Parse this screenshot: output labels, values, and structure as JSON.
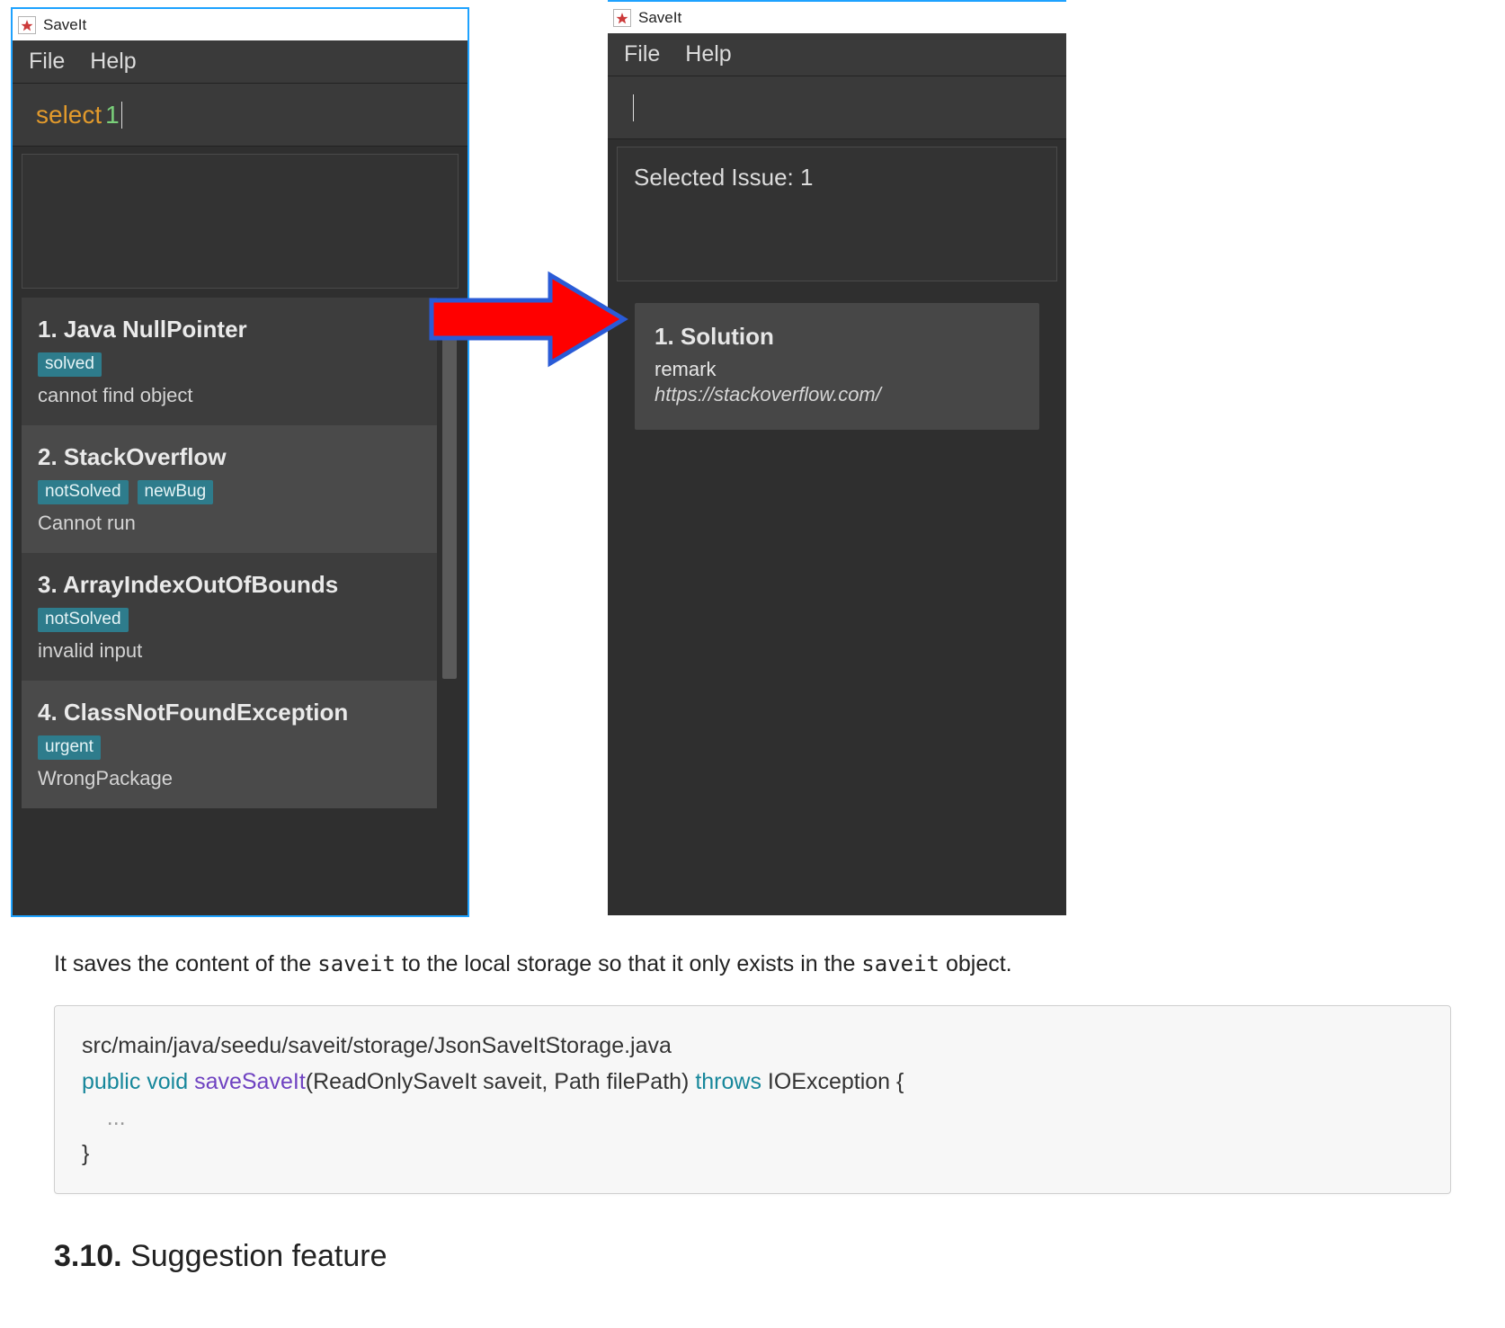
{
  "app": {
    "title": "SaveIt"
  },
  "menu": {
    "file": "File",
    "help": "Help"
  },
  "left": {
    "command_kw": "select",
    "command_arg": "1",
    "status": "",
    "issues": [
      {
        "title": "1.   Java NullPointer",
        "tags": [
          "solved"
        ],
        "desc": "cannot find object"
      },
      {
        "title": "2.   StackOverflow",
        "tags": [
          "notSolved",
          "newBug"
        ],
        "desc": "Cannot run"
      },
      {
        "title": "3.   ArrayIndexOutOfBounds",
        "tags": [
          "notSolved"
        ],
        "desc": "invalid input"
      },
      {
        "title": "4.   ClassNotFoundException",
        "tags": [
          "urgent"
        ],
        "desc": "WrongPackage"
      }
    ]
  },
  "right": {
    "status": "Selected Issue: 1",
    "solution": {
      "title": "1. Solution",
      "remark": "remark",
      "link": "https://stackoverflow.com/"
    }
  },
  "doc": {
    "lead_prefix": "It saves the content of the ",
    "lead_code1": "saveit",
    "lead_mid": " to the local storage so that it only exists in the ",
    "lead_code2": "saveit",
    "lead_suffix": " object.",
    "code": {
      "l1_path": "src/main/java/seedu/saveit/storage/JsonSaveItStorage.java",
      "l2_a": "public void ",
      "l2_b": "saveSaveIt",
      "l2_c": "(ReadOnlySaveIt saveit, Path filePath) ",
      "l2_d": "throws",
      "l2_e": " IOException {",
      "l3": "    ...",
      "l4": "}"
    },
    "section_a": "3.10.",
    "section_b": " Suggestion feature"
  }
}
